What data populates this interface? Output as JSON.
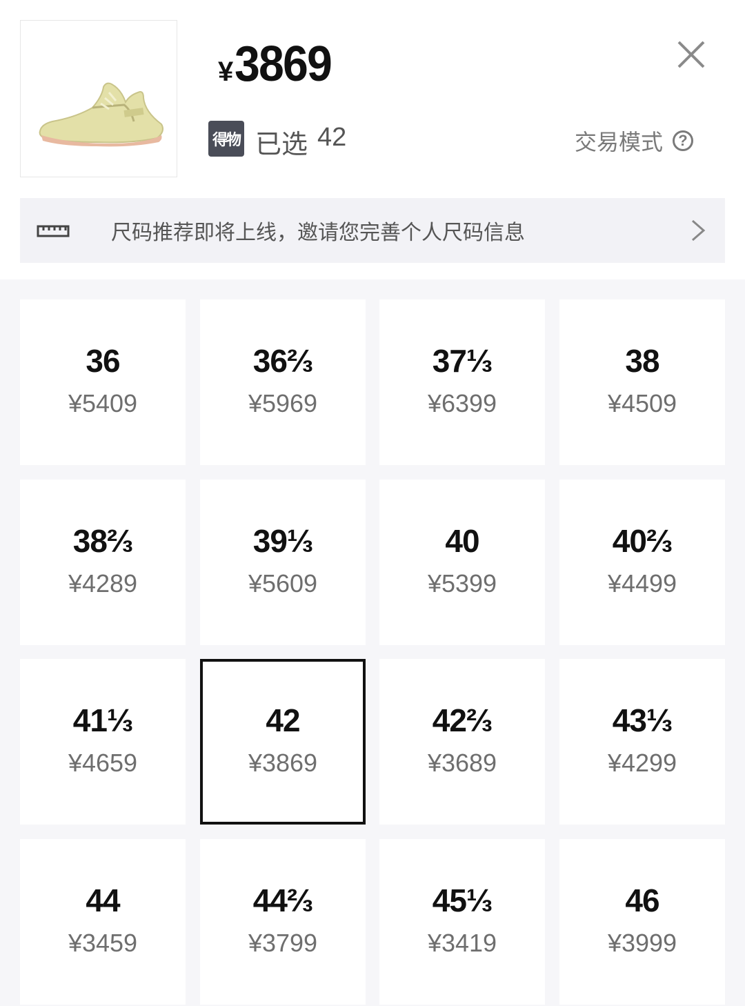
{
  "product": {
    "price_currency": "¥",
    "price_value": "3869",
    "badge_text": "得物",
    "selected_label": "已选",
    "selected_size": "42",
    "trade_mode_label": "交易模式",
    "help_symbol": "?"
  },
  "banner": {
    "text": "尺码推荐即将上线，邀请您完善个人尺码信息"
  },
  "sizes": [
    {
      "size": "36",
      "price": "¥5409"
    },
    {
      "size": "36⅔",
      "price": "¥5969"
    },
    {
      "size": "37⅓",
      "price": "¥6399"
    },
    {
      "size": "38",
      "price": "¥4509"
    },
    {
      "size": "38⅔",
      "price": "¥4289"
    },
    {
      "size": "39⅓",
      "price": "¥5609"
    },
    {
      "size": "40",
      "price": "¥5399"
    },
    {
      "size": "40⅔",
      "price": "¥4499"
    },
    {
      "size": "41⅓",
      "price": "¥4659"
    },
    {
      "size": "42",
      "price": "¥3869"
    },
    {
      "size": "42⅔",
      "price": "¥3689"
    },
    {
      "size": "43⅓",
      "price": "¥4299"
    },
    {
      "size": "44",
      "price": "¥3459"
    },
    {
      "size": "44⅔",
      "price": "¥3799"
    },
    {
      "size": "45⅓",
      "price": "¥3419"
    },
    {
      "size": "46",
      "price": "¥3999"
    }
  ],
  "colors": {
    "selected_border": "#111111",
    "grid_background": "#f6f6f9",
    "badge_background": "#4a4d58",
    "sneaker_body": "#e3e0a8"
  }
}
